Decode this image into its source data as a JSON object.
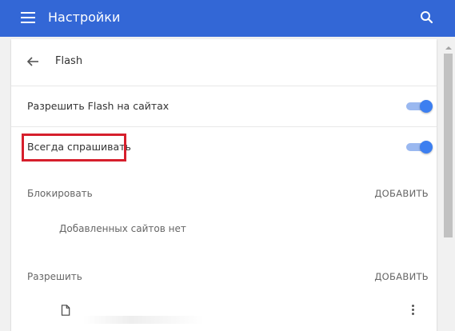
{
  "appbar": {
    "title": "Настройки",
    "color": "#3367d6",
    "menu_icon": "hamburger-menu-icon",
    "search_icon": "search-icon"
  },
  "page": {
    "back_icon": "arrow-back-icon",
    "title": "Flash"
  },
  "settings": {
    "allow_flash": {
      "label": "Разрешить Flash на сайтах",
      "enabled": true
    },
    "always_ask": {
      "label": "Всегда спрашивать",
      "enabled": true,
      "highlighted": true
    }
  },
  "block_section": {
    "label": "Блокировать",
    "add_label": "ДОБАВИТЬ",
    "empty_text": "Добавленных сайтов нет"
  },
  "allow_section": {
    "label": "Разрешить",
    "add_label": "ДОБАВИТЬ",
    "site_icon": "file-icon",
    "more_icon": "more-vert-icon"
  },
  "colors": {
    "accent": "#3d7ff0",
    "highlight": "#d61f2c"
  }
}
